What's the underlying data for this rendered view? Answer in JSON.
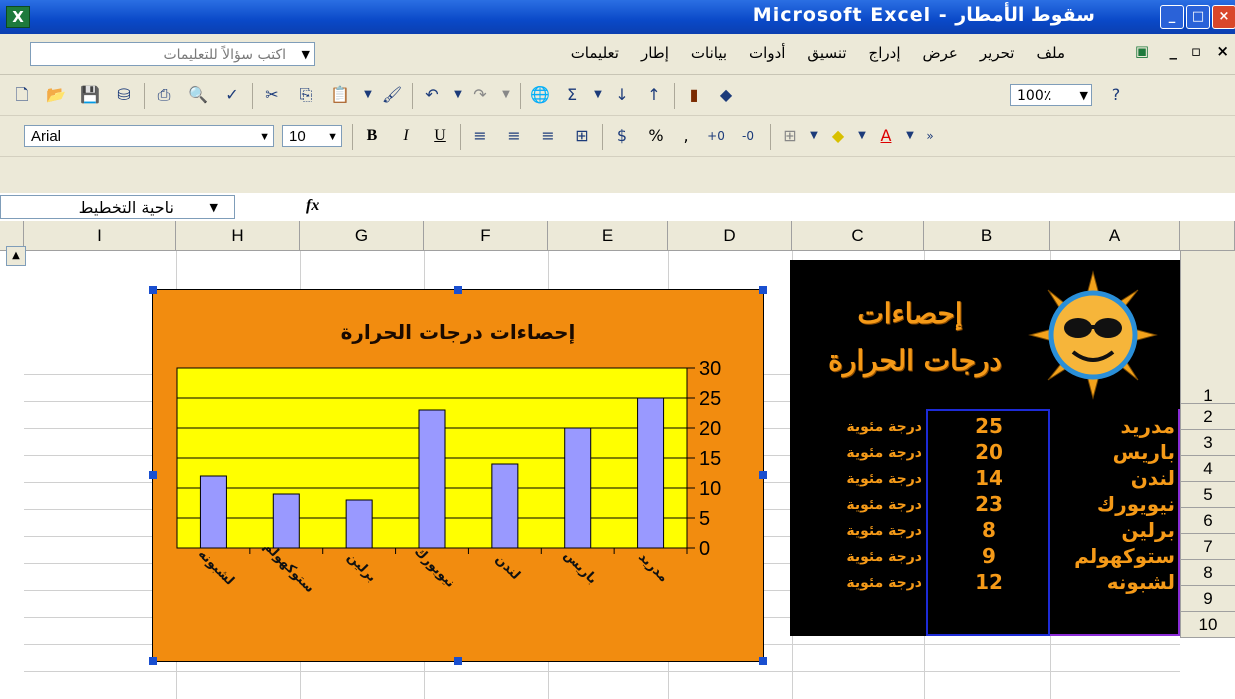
{
  "window": {
    "title": "Microsoft Excel - سقوط الأمطار"
  },
  "menubar": {
    "help_placeholder": "اكتب سؤالاً للتعليمات",
    "items": [
      "ملف",
      "تحرير",
      "عرض",
      "إدراج",
      "تنسيق",
      "أدوات",
      "بيانات",
      "إطار",
      "تعليمات"
    ]
  },
  "toolbar": {
    "zoom": "100٪",
    "font": "Arial",
    "size": "10"
  },
  "formula": {
    "name_box": "ناحية التخطيط",
    "fx": "fx"
  },
  "columns": [
    "I",
    "H",
    "G",
    "F",
    "E",
    "D",
    "C",
    "B",
    "A"
  ],
  "rows": [
    "1",
    "2",
    "3",
    "4",
    "5",
    "6",
    "7",
    "8",
    "9",
    "10"
  ],
  "sheet": {
    "heading_line1": "إحصاءات",
    "heading_line2": "درجات الحرارة",
    "table": [
      {
        "city": "مدريد",
        "value": "25",
        "unit": "درجة مئوية"
      },
      {
        "city": "باريس",
        "value": "20",
        "unit": "درجة مئوية"
      },
      {
        "city": "لندن",
        "value": "14",
        "unit": "درجة مئوية"
      },
      {
        "city": "نيويورك",
        "value": "23",
        "unit": "درجة مئوية"
      },
      {
        "city": "برلين",
        "value": "8",
        "unit": "درجة مئوية"
      },
      {
        "city": "ستوكهولم",
        "value": "9",
        "unit": "درجة مئوية"
      },
      {
        "city": "لشبونه",
        "value": "12",
        "unit": "درجة مئوية"
      }
    ]
  },
  "chart_data": {
    "type": "bar",
    "title": "إحصاءات درجات الحرارة",
    "categories": [
      "لشبونه",
      "ستوكهولم",
      "برلين",
      "نيويورك",
      "لندن",
      "باريس",
      "مدريد"
    ],
    "values": [
      12,
      9,
      8,
      23,
      14,
      20,
      25
    ],
    "ylim": [
      0,
      30
    ],
    "yticks": [
      "0",
      "5",
      "10",
      "15",
      "20",
      "25",
      "30"
    ],
    "grid": true,
    "colors": {
      "plot_bg": "#ffff00",
      "chart_bg": "#f28c0f",
      "bar": "#9999ff"
    }
  }
}
